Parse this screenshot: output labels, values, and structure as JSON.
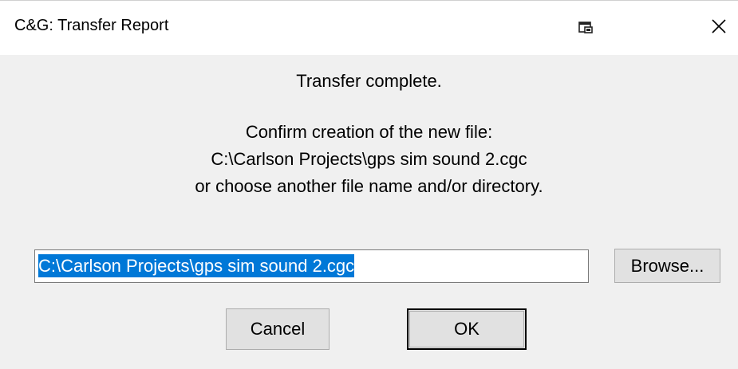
{
  "window": {
    "title": "C&G: Transfer Report"
  },
  "titlebar": {
    "pin_icon": "window-pin-icon",
    "close_icon": "close-icon"
  },
  "message": {
    "line1": "Transfer complete.",
    "line2": "Confirm creation of the new file:",
    "line3": "C:\\Carlson Projects\\gps sim sound 2.cgc",
    "line4": "or choose another file name and/or directory."
  },
  "file_path": {
    "value": "C:\\Carlson Projects\\gps sim sound 2.cgc"
  },
  "buttons": {
    "browse": "Browse...",
    "cancel": "Cancel",
    "ok": "OK"
  },
  "colors": {
    "selection": "#0078d7",
    "dialog_bg": "#f0f0f0",
    "titlebar_bg": "#ffffff"
  }
}
